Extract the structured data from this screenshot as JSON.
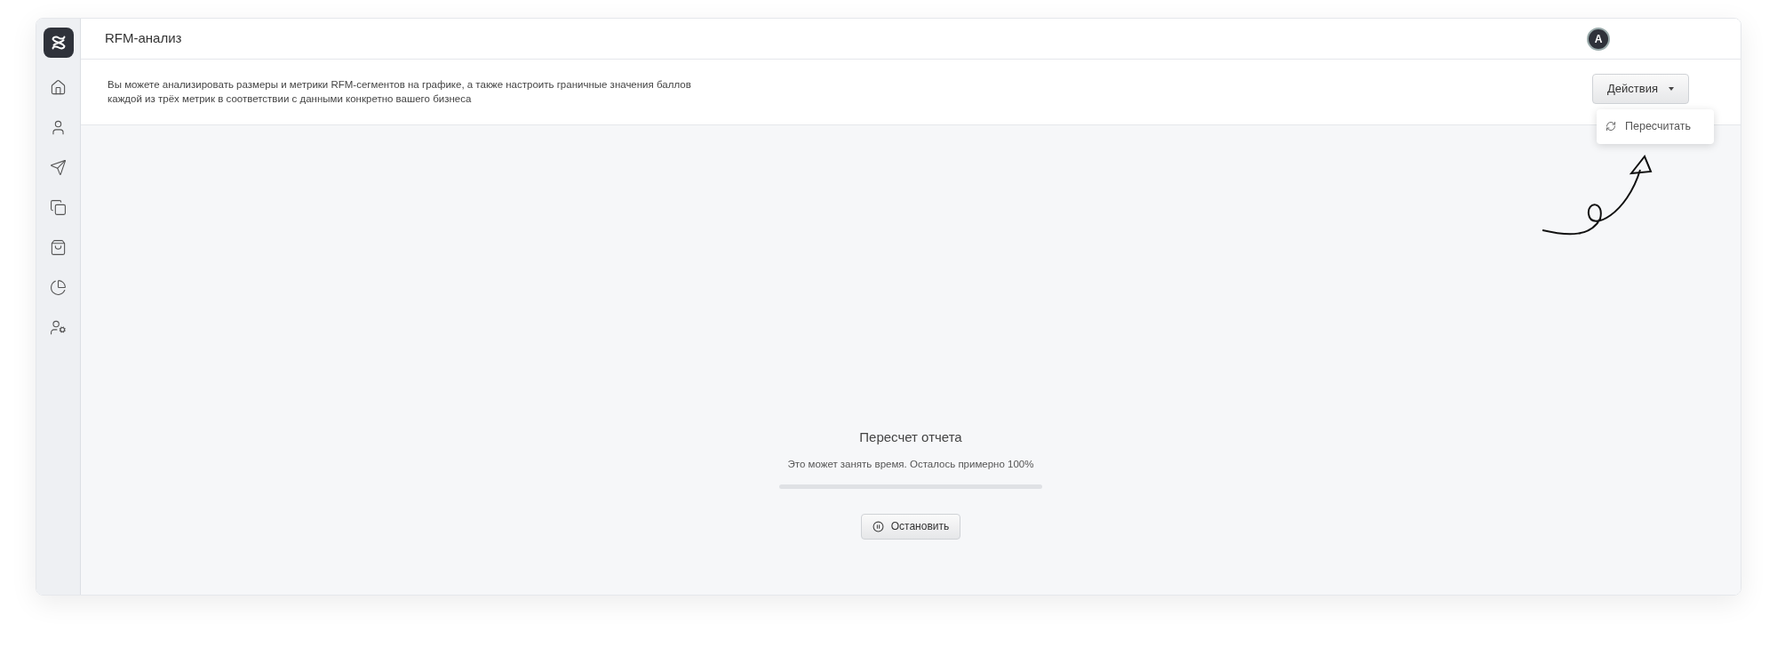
{
  "header": {
    "title": "RFM-анализ",
    "avatar": "A"
  },
  "sidebar": {
    "items": [
      {
        "kind": "home",
        "selected": false
      },
      {
        "kind": "user",
        "selected": false
      },
      {
        "kind": "send",
        "selected": false
      },
      {
        "kind": "copy",
        "selected": false
      },
      {
        "kind": "bag",
        "selected": false
      },
      {
        "kind": "pie",
        "selected": false
      },
      {
        "kind": "user-settings",
        "selected": false
      }
    ]
  },
  "description": "Вы можете анализировать размеры и метрики RFM-сегментов на графике, а также настроить граничные значения баллов каждой из трёх метрик в соответствии с данными конкретно вашего бизнеса",
  "actions_button": {
    "label": "Действия",
    "expanded": true
  },
  "actions_menu": [
    {
      "label": "Пересчитать"
    }
  ],
  "progress": {
    "title": "Пересчет отчета",
    "message": "Это может занять время. Осталось примерно 100%",
    "level": 0,
    "stop_button": "Остановить"
  }
}
